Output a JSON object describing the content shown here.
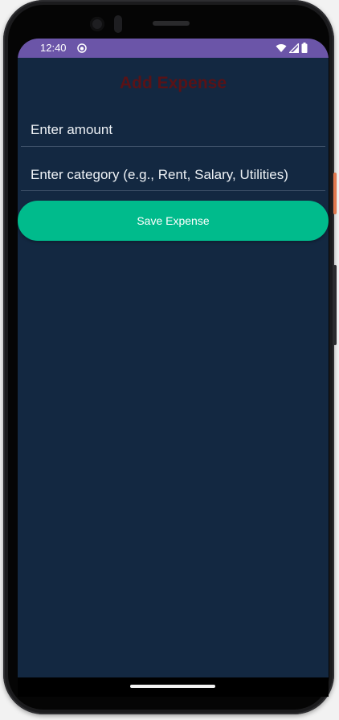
{
  "status_bar": {
    "time": "12:40"
  },
  "page": {
    "title": "Add Expense"
  },
  "form": {
    "amount_placeholder": "Enter amount",
    "category_placeholder": "Enter category (e.g., Rent, Salary, Utilities)",
    "save_label": "Save Expense"
  },
  "colors": {
    "status_bar": "#6b55a8",
    "background": "#132841",
    "title": "#5a1216",
    "save_button": "#00bb8c"
  },
  "icons": {
    "status_app": "app-notification-icon",
    "wifi": "wifi-icon",
    "signal": "cell-signal-icon",
    "battery": "battery-icon"
  }
}
